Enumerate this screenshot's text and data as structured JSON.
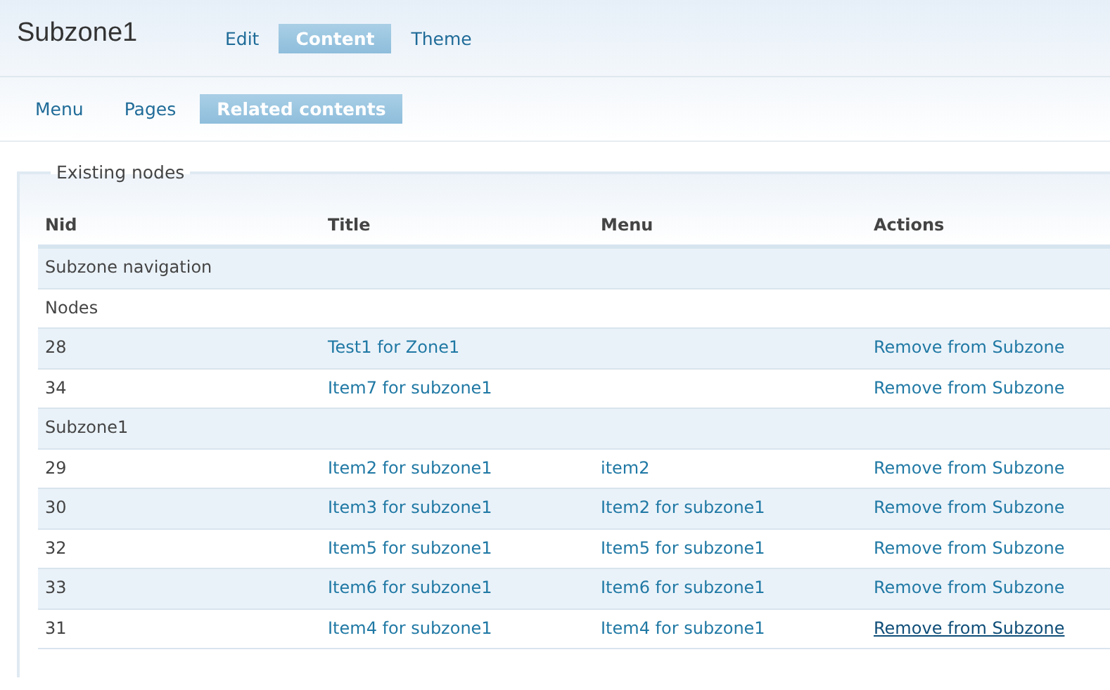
{
  "page_title": "Subzone1",
  "primary_tabs": [
    {
      "label": "Edit",
      "selected": false
    },
    {
      "label": "Content",
      "selected": true
    },
    {
      "label": "Theme",
      "selected": false
    }
  ],
  "secondary_tabs": [
    {
      "label": "Menu",
      "selected": false
    },
    {
      "label": "Pages",
      "selected": false
    },
    {
      "label": "Related contents",
      "selected": true
    }
  ],
  "fieldset": {
    "legend": "Existing nodes"
  },
  "table": {
    "columns": [
      "Nid",
      "Title",
      "Menu",
      "Actions"
    ],
    "rows": [
      {
        "kind": "group",
        "label": "Subzone navigation"
      },
      {
        "kind": "group",
        "label": "Nodes"
      },
      {
        "kind": "node",
        "nid": "28",
        "title": "Test1 for Zone1",
        "action": "Remove from Subzone",
        "hovered": false
      },
      {
        "kind": "node",
        "nid": "34",
        "title": "Item7 for subzone1",
        "action": "Remove from Subzone",
        "hovered": false
      },
      {
        "kind": "group",
        "label": "Subzone1"
      },
      {
        "kind": "node",
        "nid": "29",
        "title": "Item2 for subzone1",
        "menu": "item2",
        "action": "Remove from Subzone",
        "hovered": false
      },
      {
        "kind": "node",
        "nid": "30",
        "title": "Item3 for subzone1",
        "menu": "Item2 for subzone1",
        "action": "Remove from Subzone",
        "hovered": false
      },
      {
        "kind": "node",
        "nid": "32",
        "title": "Item5 for subzone1",
        "menu": "Item5 for subzone1",
        "action": "Remove from Subzone",
        "hovered": false
      },
      {
        "kind": "node",
        "nid": "33",
        "title": "Item6 for subzone1",
        "menu": "Item6 for subzone1",
        "action": "Remove from Subzone",
        "hovered": false
      },
      {
        "kind": "node",
        "nid": "31",
        "title": "Item4 for subzone1",
        "menu": "Item4 for subzone1",
        "action": "Remove from Subzone",
        "hovered": true
      }
    ]
  }
}
